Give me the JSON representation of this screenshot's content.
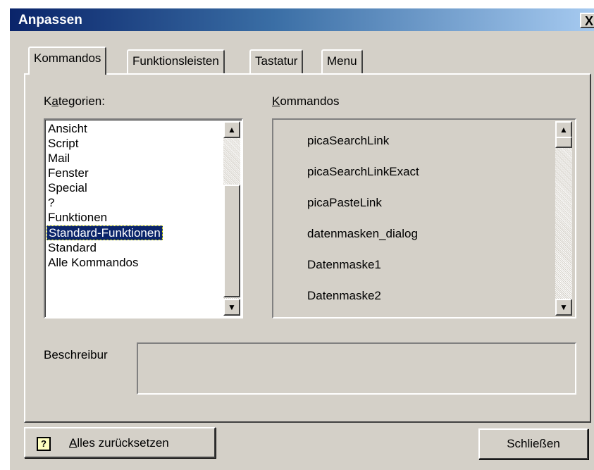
{
  "window": {
    "title": "Anpassen",
    "close_glyph": "X"
  },
  "tabs": [
    {
      "label": "Kommandos",
      "active": true
    },
    {
      "label": "Funktionsleisten",
      "active": false
    },
    {
      "label": "Tastatur",
      "active": false
    },
    {
      "label": "Menu",
      "active": false
    }
  ],
  "categories": {
    "label_pre": "K",
    "label_acc": "a",
    "label_post": "tegorien:",
    "items": [
      "Ansicht",
      "Script",
      "Mail",
      "Fenster",
      "Special",
      "?",
      "Funktionen",
      "Standard-Funktionen",
      "Standard",
      "Alle Kommandos"
    ],
    "selected": "Standard-Funktionen"
  },
  "commands": {
    "label_acc": "K",
    "label_post": "ommandos",
    "items": [
      "picaSearchLink",
      "picaSearchLinkExact",
      "picaPasteLink",
      "datenmasken_dialog",
      "Datenmaske1",
      "Datenmaske2"
    ]
  },
  "description": {
    "label": "Beschreibur",
    "value": ""
  },
  "buttons": {
    "reset_acc": "A",
    "reset_post": "lles zurücksetzen",
    "help_glyph": "?",
    "close": "Schließen"
  },
  "icons": {
    "scroll_up": "▲",
    "scroll_down": "▼"
  }
}
